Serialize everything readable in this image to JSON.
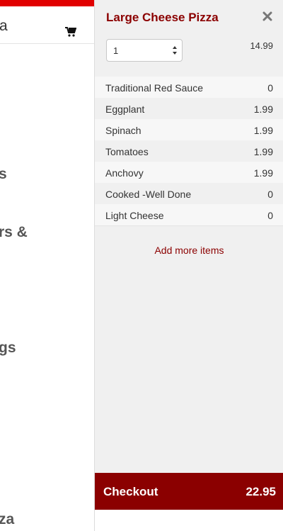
{
  "left_page": {
    "header_text": "a",
    "cart_icon": "shopping-cart-icon",
    "categories": [
      "s",
      "rs &",
      "gs",
      "za"
    ]
  },
  "drawer": {
    "title": "Large Cheese Pizza",
    "close_icon": "close-icon",
    "quantity": "1",
    "base_price": "14.99",
    "options": [
      {
        "name": "Traditional Red Sauce",
        "price": "0"
      },
      {
        "name": "Eggplant",
        "price": "1.99"
      },
      {
        "name": "Spinach",
        "price": "1.99"
      },
      {
        "name": "Tomatoes",
        "price": "1.99"
      },
      {
        "name": "Anchovy",
        "price": "1.99"
      },
      {
        "name": "Cooked -Well Done",
        "price": "0"
      },
      {
        "name": "Light Cheese",
        "price": "0"
      }
    ],
    "add_more_label": "Add more items",
    "checkout_label": "Checkout",
    "checkout_total": "22.95"
  },
  "colors": {
    "accent": "#8b0000",
    "top_bar": "#e10000",
    "drawer_bg": "#f0f0f0"
  }
}
